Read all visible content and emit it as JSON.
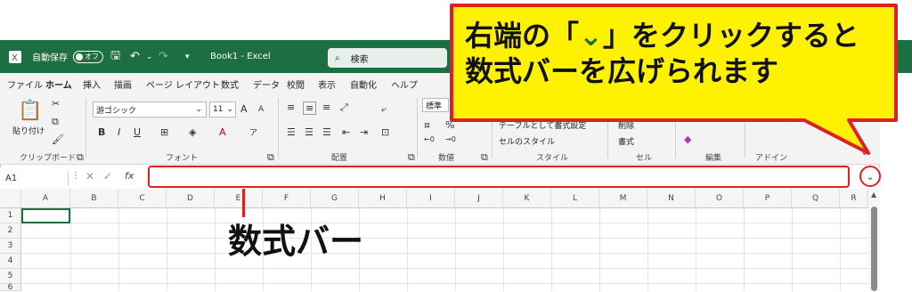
{
  "titlebar": {
    "autosave_label": "自動保存",
    "autosave_state": "オフ",
    "file_title": "Book1 - Excel",
    "search_placeholder": "検索"
  },
  "menu": {
    "tabs": [
      "ファイル",
      "ホーム",
      "挿入",
      "描画",
      "ページ レイアウト",
      "数式",
      "データ",
      "校閲",
      "表示",
      "自動化",
      "ヘルプ"
    ],
    "active": "ホーム"
  },
  "ribbon": {
    "clipboard": {
      "paste_label": "貼り付け",
      "group_label": "クリップボード"
    },
    "font": {
      "font_name": "游ゴシック",
      "font_size": "11",
      "group_label": "フォント",
      "grow": "A",
      "shrink": "A",
      "bold": "B",
      "italic": "I",
      "underline": "U"
    },
    "alignment": {
      "group_label": "配置"
    },
    "number": {
      "format": "標準",
      "group_label": "数値"
    },
    "styles": {
      "conditional": "テーブルとして書式設定",
      "cell_styles": "セルのスタイル",
      "group_label": "スタイル"
    },
    "cells": {
      "delete": "削除",
      "format": "書式",
      "group_label": "セル"
    },
    "editing": {
      "group_label": "編集"
    },
    "addins": {
      "group_label": "アドイン"
    }
  },
  "formula_bar": {
    "name_box": "A1",
    "fx": "fx",
    "formula": ""
  },
  "grid": {
    "columns": [
      "A",
      "B",
      "C",
      "D",
      "E",
      "F",
      "G",
      "H",
      "I",
      "J",
      "K",
      "L",
      "M",
      "N",
      "O",
      "P",
      "Q",
      "R"
    ],
    "rows": [
      "1",
      "2",
      "3",
      "4",
      "5",
      "6"
    ]
  },
  "annotations": {
    "callout_line1": "右端の「",
    "callout_chevron": "⌄",
    "callout_line1_end": "」をクリックすると",
    "callout_line2": "数式バーを広げられます",
    "formula_bar_label": "数式バー"
  },
  "colors": {
    "excel_green": "#1d6f42",
    "callout_yellow": "#fff200",
    "annotation_red": "#e02020"
  }
}
